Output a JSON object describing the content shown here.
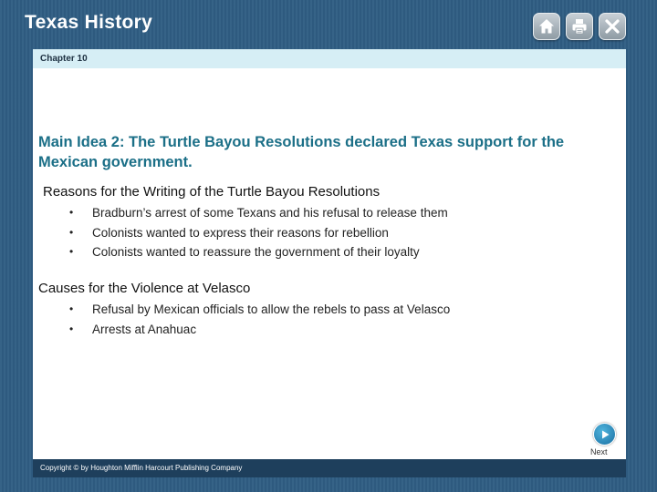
{
  "header": {
    "title": "Texas History",
    "buttons": [
      {
        "icon": "home-icon"
      },
      {
        "icon": "print-icon"
      },
      {
        "icon": "close-icon"
      }
    ]
  },
  "slide": {
    "chapter": "Chapter 10",
    "main_idea": "Main Idea 2: The Turtle Bayou Resolutions declared Texas support for the Mexican government.",
    "sections": [
      {
        "heading": "Reasons for the Writing of the Turtle Bayou Resolutions",
        "bullets": [
          "Bradburn’s arrest of some Texans and his refusal to release them",
          "Colonists wanted to express their reasons for rebellion",
          "Colonists wanted to reassure the government of their loyalty"
        ]
      },
      {
        "heading": "Causes for the Violence at Velasco",
        "bullets": [
          "Refusal by Mexican officials to allow the rebels to pass at Velasco",
          "Arrests at Anahuac"
        ]
      }
    ],
    "bullet_symbol": "•"
  },
  "navigation": {
    "next_label": "Next",
    "next_icon": "play-arrow-icon"
  },
  "footer": {
    "copyright": "Copyright © by Houghton Mifflin Harcourt Publishing Company"
  },
  "colors": {
    "background": "#2f5d83",
    "chapter_bar": "#d6eef5",
    "main_idea_text": "#1b6f87",
    "footer_bar": "#1e3f5c"
  }
}
